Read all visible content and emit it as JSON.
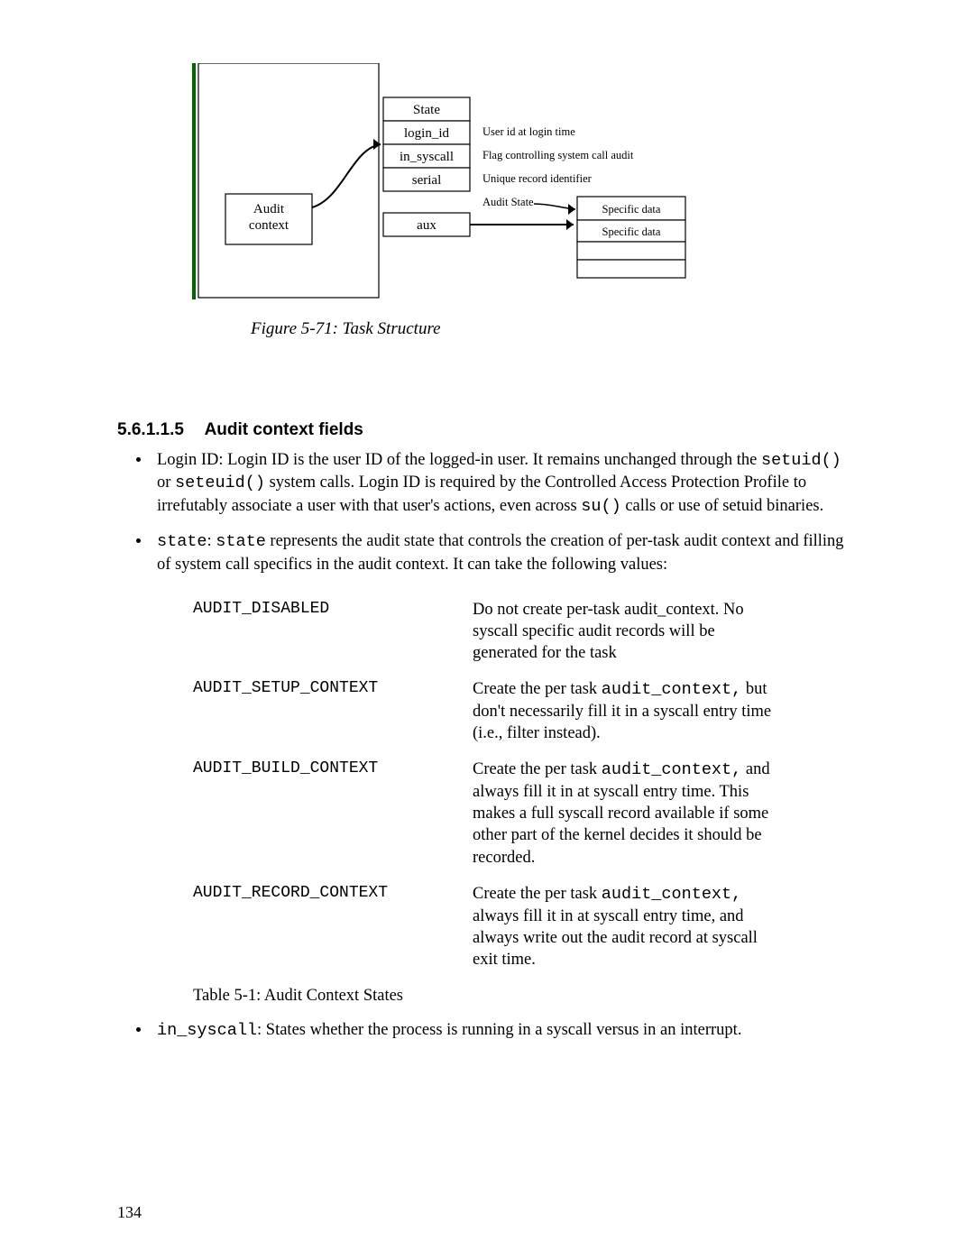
{
  "figure": {
    "audit_context": "Audit\ncontext",
    "state_header": "State",
    "login_id": "login_id",
    "in_syscall": "in_syscall",
    "serial": "serial",
    "aux": "aux",
    "desc_login": "User id at login time",
    "desc_syscall": "Flag controlling system call audit",
    "desc_serial": "Unique record identifier",
    "audit_state": "Audit State",
    "specific_data": "Specific data"
  },
  "figure_caption": "Figure 5-71: Task Structure",
  "section": {
    "number": "5.6.1.1.5",
    "title": "Audit context fields"
  },
  "bullets": {
    "login_prefix": "Login ID:  Login ID is the user ID of the logged-in user.  It remains unchanged through the ",
    "login_code1": "setuid()",
    "login_mid": " or ",
    "login_code2": "seteuid()",
    "login_after": "  system calls.  Login ID is required by the Controlled Access Protection Profile to irrefutably associate a user with that user's actions, even across ",
    "login_code3": "su()",
    "login_tail": " calls or use of setuid binaries.",
    "state_code1": "state",
    "state_sep": ": ",
    "state_code2": "state",
    "state_rest": " represents the audit state that controls the creation of per-task audit context and filling of system call specifics in the audit context.  It can take the following values:"
  },
  "states": [
    {
      "name": "AUDIT_DISABLED",
      "pre": "Do not create per-task audit_context. No syscall specific audit records will be generated for the task"
    },
    {
      "name": "AUDIT_SETUP_CONTEXT",
      "pre": "Create the per task ",
      "code": "audit_context,",
      "post": " but don't necessarily fill it in a syscall entry time (i.e., filter instead)."
    },
    {
      "name": "AUDIT_BUILD_CONTEXT",
      "pre": "Create the per task ",
      "code": "audit_context,",
      "post": " and always fill it in at syscall entry time. This makes a full syscall record available if some other part of the kernel decides it should be recorded."
    },
    {
      "name": "AUDIT_RECORD_CONTEXT",
      "pre": "Create the per task ",
      "code": "audit_context,",
      "post": " always fill it in at syscall entry time, and always write out the audit record at syscall exit time."
    }
  ],
  "table_caption": "Table 5-1: Audit Context States",
  "last_bullet": {
    "code": "in_syscall",
    "text": ":  States whether the process is running in a syscall versus in an interrupt."
  },
  "page_number": "134"
}
